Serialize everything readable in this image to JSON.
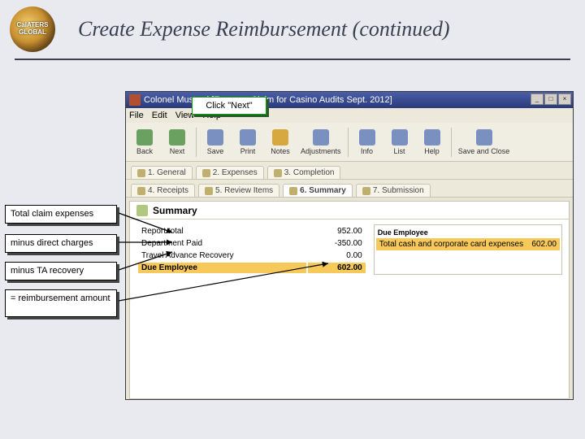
{
  "slide": {
    "title": "Create Expense Reimbursement (continued)",
    "logo_line1": "CalATERS",
    "logo_line2": "GLOBAL"
  },
  "window": {
    "title": "Colonel Mustard [Expense Claim for Casino Audits Sept. 2012]",
    "menus": [
      "File",
      "Edit",
      "View",
      "Help"
    ],
    "toolbar": [
      {
        "label": "Back"
      },
      {
        "label": "Next"
      },
      {
        "label": "Save"
      },
      {
        "label": "Print"
      },
      {
        "label": "Notes"
      },
      {
        "label": "Adjustments"
      },
      {
        "label": "Info"
      },
      {
        "label": "List"
      },
      {
        "label": "Help"
      },
      {
        "label": "Save and Close"
      }
    ],
    "tabs_row1": [
      {
        "label": "1. General"
      },
      {
        "label": "2. Expenses"
      },
      {
        "label": "3. Completion"
      }
    ],
    "tabs_row2": [
      {
        "label": "4. Receipts"
      },
      {
        "label": "5. Review Items"
      },
      {
        "label": "6. Summary",
        "active": true
      },
      {
        "label": "7. Submission"
      }
    ],
    "summary": {
      "header": "Summary",
      "rows": [
        {
          "label": "Report total",
          "value": "952.00"
        },
        {
          "label": "Department Paid",
          "value": "-350.00"
        },
        {
          "label": "Travel Advance Recovery",
          "value": "0.00"
        },
        {
          "label": "Due Employee",
          "value": "602.00",
          "highlight": true
        }
      ],
      "right": {
        "header": "Due Employee",
        "line_label": "Total cash and corporate card expenses",
        "line_value": "602.00"
      }
    }
  },
  "callouts": {
    "next": "Click \"Next\"",
    "a1": "Total claim expenses",
    "a2": "minus direct charges",
    "a3": "minus TA recovery",
    "a4": "= reimbursement amount"
  }
}
